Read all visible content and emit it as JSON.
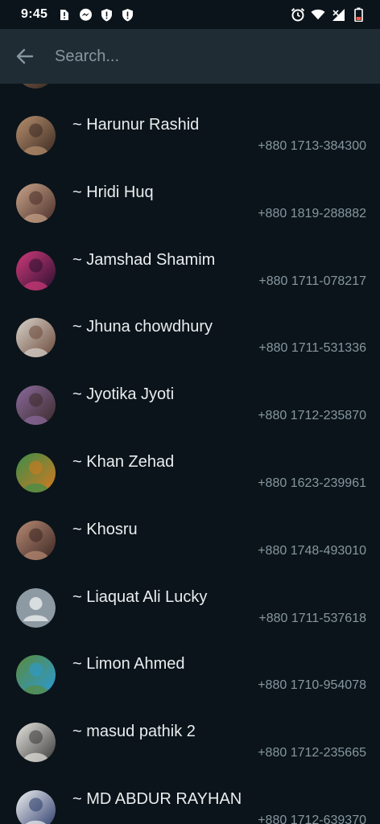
{
  "status_bar": {
    "time": "9:45",
    "left_icons": [
      "sim-alert-icon",
      "messenger-icon",
      "shield-alert-icon",
      "shield-alert-icon"
    ],
    "right_icons": [
      "alarm-icon",
      "wifi-icon",
      "signal-icon",
      "battery-low-icon"
    ]
  },
  "search": {
    "placeholder": "Search...",
    "value": ""
  },
  "contacts": [
    {
      "name": "~ Harunur Rashid",
      "phone": "+880 1713-384300",
      "avatar_colors": [
        "#b7906e",
        "#3b2a22"
      ]
    },
    {
      "name": "~ Hridi Huq",
      "phone": "+880 1819-288882",
      "avatar_colors": [
        "#c9a489",
        "#4a2e2a"
      ]
    },
    {
      "name": "~ Jamshad Shamim",
      "phone": "+880 1711-078217",
      "avatar_colors": [
        "#d03a7a",
        "#2a1030"
      ]
    },
    {
      "name": "~ Jhuna chowdhury",
      "phone": "+880 1711-531336",
      "avatar_colors": [
        "#d9d3cc",
        "#6b4a3a"
      ]
    },
    {
      "name": "~ Jyotika Jyoti",
      "phone": "+880 1712-235870",
      "avatar_colors": [
        "#8c6b9e",
        "#3a2a2a"
      ]
    },
    {
      "name": "~ Khan Zehad",
      "phone": "+880 1623-239961",
      "avatar_colors": [
        "#3a8e4a",
        "#d6781f"
      ]
    },
    {
      "name": "~ Khosru",
      "phone": "+880 1748-493010",
      "avatar_colors": [
        "#b88a74",
        "#3b2622"
      ]
    },
    {
      "name": "~ Liaquat Ali Lucky",
      "phone": "+880 1711-537618",
      "avatar_colors": [
        "#8e9aa3",
        "#d8dde0"
      ]
    },
    {
      "name": "~ Limon Ahmed",
      "phone": "+880 1710-954078",
      "avatar_colors": [
        "#5a8a3a",
        "#2a9ad8"
      ]
    },
    {
      "name": "~ masud pathik 2",
      "phone": "+880 1712-235665",
      "avatar_colors": [
        "#e8e6e0",
        "#3a3a3a"
      ]
    },
    {
      "name": "~ MD ABDUR RAYHAN",
      "phone": "+880 1712-639370",
      "avatar_colors": [
        "#f2f2f2",
        "#2a3a6a"
      ]
    }
  ],
  "colors": {
    "background": "#0b141a",
    "search_bar": "#1f2c34",
    "primary_text": "#e9edef",
    "secondary_text": "#8696a0"
  }
}
